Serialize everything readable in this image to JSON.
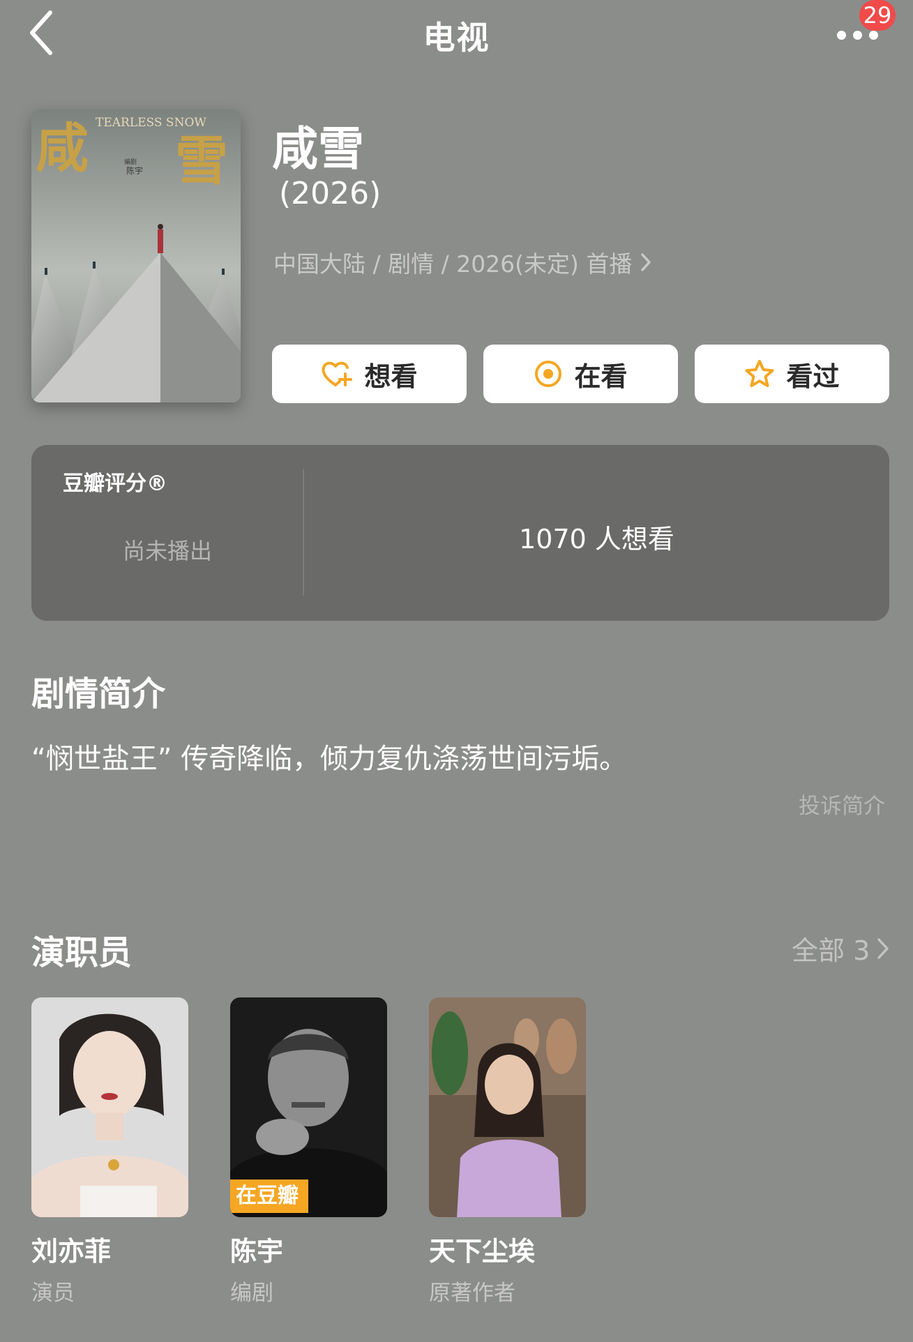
{
  "header": {
    "title": "电视",
    "notification_count": "29"
  },
  "poster": {
    "title_art": "咸雪",
    "english_art": "TEARLESS SNOW",
    "writer_credit": "编剧",
    "writer_name": "陈宇"
  },
  "show": {
    "title": "咸雪",
    "year": " (2026)",
    "meta": "中国大陆 / 剧情 / 2026(未定) 首播"
  },
  "actions": {
    "want_label": "想看",
    "watching_label": "在看",
    "watched_label": "看过"
  },
  "rating": {
    "label": "豆瓣评分®",
    "status": "尚未播出",
    "want_count": "1070 人想看"
  },
  "synopsis": {
    "heading": "剧情简介",
    "text": "“悯世盐王” 传奇降临，倾力复仇涤荡世间污垢。",
    "report_label": "投诉简介"
  },
  "cast": {
    "heading": "演职员",
    "all_label": "全部 3",
    "members": [
      {
        "name": "刘亦菲",
        "role": "演员",
        "tag": ""
      },
      {
        "name": "陈宇",
        "role": "编剧",
        "tag": "在豆瓣"
      },
      {
        "name": "天下尘埃",
        "role": "原著作者",
        "tag": ""
      }
    ]
  },
  "colors": {
    "background": "#8b8d8a",
    "card": "#6a6a69",
    "accent": "#f5a623",
    "badge": "#f04a4a"
  },
  "icons": {
    "back": "chevron-left-icon",
    "more": "more-dots-icon",
    "want": "heart-plus-icon",
    "watching": "target-icon",
    "watched": "star-icon"
  }
}
